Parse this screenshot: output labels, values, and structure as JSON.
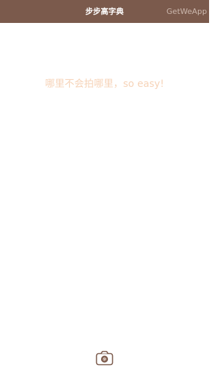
{
  "header": {
    "title": "步步高字典",
    "watermark": "GetWeApp"
  },
  "main": {
    "slogan": "哪里不会拍哪里，so easy!"
  },
  "camera": {
    "icon": "camera-icon"
  },
  "colors": {
    "header_bg": "#7b5a4c",
    "slogan": "#f6d3b8",
    "camera_lens": "#7b5a4c"
  }
}
